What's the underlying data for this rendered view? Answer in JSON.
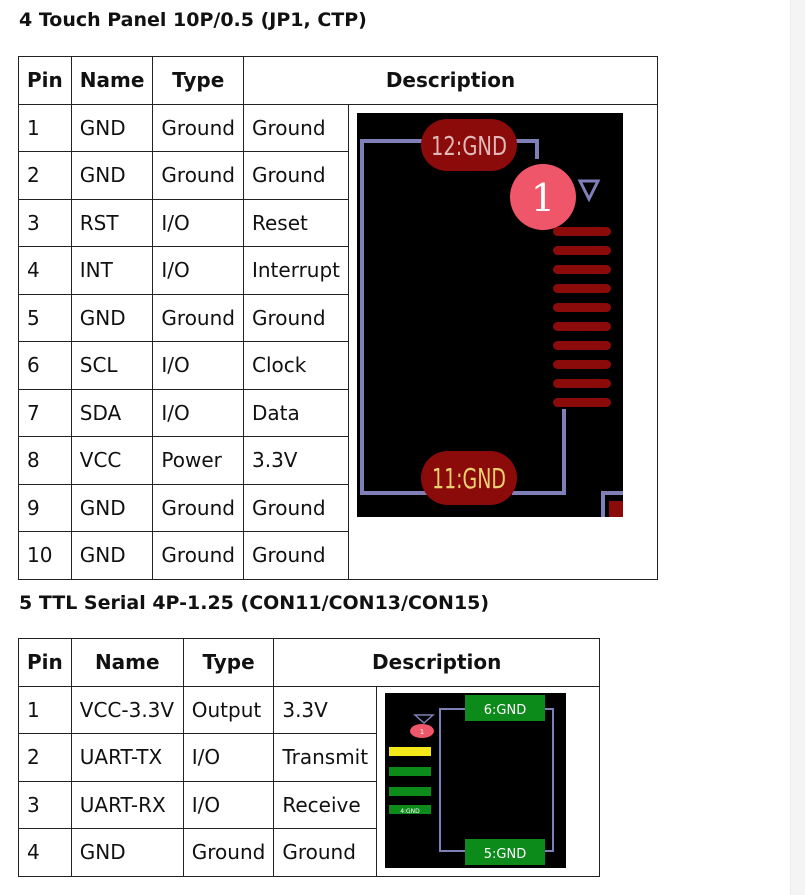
{
  "section4": {
    "title": "4 Touch Panel 10P/0.5 (JP1, CTP)",
    "headers": {
      "pin": "Pin",
      "name": "Name",
      "type": "Type",
      "description": "Description"
    },
    "rows": [
      {
        "pin": "1",
        "name": "GND",
        "type": "Ground",
        "desc": "Ground"
      },
      {
        "pin": "2",
        "name": "GND",
        "type": "Ground",
        "desc": "Ground"
      },
      {
        "pin": "3",
        "name": "RST",
        "type": "I/O",
        "desc": "Reset"
      },
      {
        "pin": "4",
        "name": "INT",
        "type": "I/O",
        "desc": "Interrupt"
      },
      {
        "pin": "5",
        "name": "GND",
        "type": "Ground",
        "desc": "Ground"
      },
      {
        "pin": "6",
        "name": "SCL",
        "type": "I/O",
        "desc": "Clock"
      },
      {
        "pin": "7",
        "name": "SDA",
        "type": "I/O",
        "desc": "Data"
      },
      {
        "pin": "8",
        "name": "VCC",
        "type": "Power",
        "desc": "3.3V"
      },
      {
        "pin": "9",
        "name": "GND",
        "type": "Ground",
        "desc": "Ground"
      },
      {
        "pin": "10",
        "name": "GND",
        "type": "Ground",
        "desc": "Ground"
      }
    ],
    "image": {
      "pad_top": "12:GND",
      "pad_bottom": "11:GND",
      "marker": "1"
    }
  },
  "section5": {
    "title": "5 TTL Serial 4P-1.25 (CON11/CON13/CON15)",
    "headers": {
      "pin": "Pin",
      "name": "Name",
      "type": "Type",
      "description": "Description"
    },
    "rows": [
      {
        "pin": "1",
        "name": "VCC-3.3V",
        "type": "Output",
        "desc": "3.3V"
      },
      {
        "pin": "2",
        "name": "UART-TX",
        "type": "I/O",
        "desc": "Transmit"
      },
      {
        "pin": "3",
        "name": "UART-RX",
        "type": "I/O",
        "desc": "Receive"
      },
      {
        "pin": "4",
        "name": "GND",
        "type": "Ground",
        "desc": "Ground"
      }
    ],
    "image": {
      "pad_top": "6:GND",
      "pad_bottom": "5:GND",
      "marker": "1",
      "small_pad": "4:GND"
    }
  },
  "colors": {
    "pcb_bg": "#000000",
    "pad_red": "#8b0a0a",
    "trace_blue": "#8080b8",
    "marker_pink": "#f0566a",
    "pad_green": "#0c8a1a",
    "pad_yellow": "#f2e81a"
  }
}
